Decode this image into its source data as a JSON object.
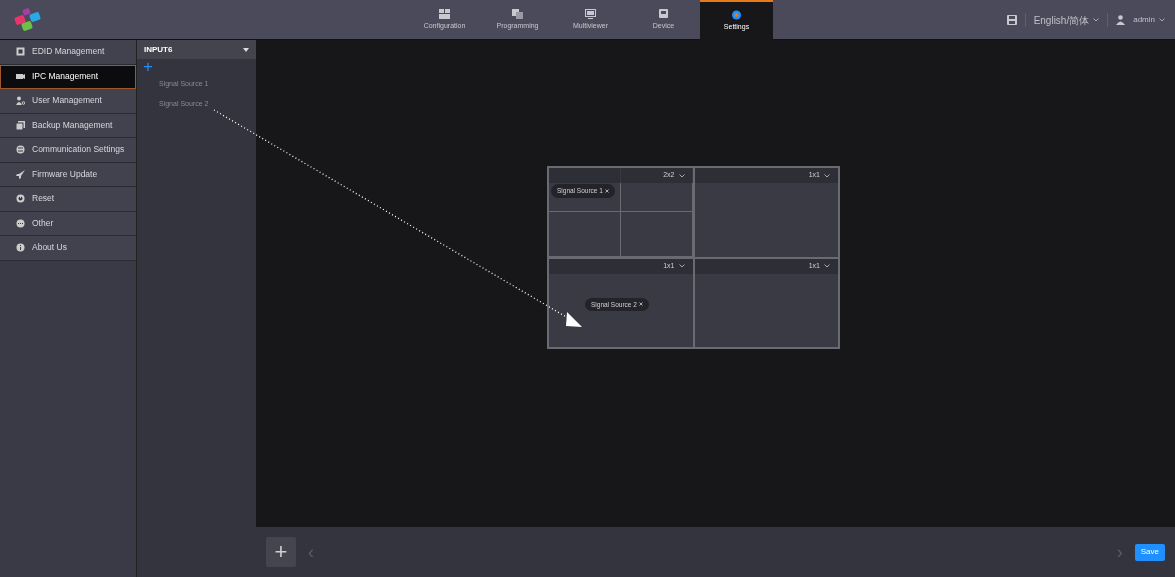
{
  "nav_tabs": [
    {
      "label": "Configuration",
      "selected": false
    },
    {
      "label": "Programming",
      "selected": false
    },
    {
      "label": "Multiviewer",
      "selected": false
    },
    {
      "label": "Device",
      "selected": false
    },
    {
      "label": "Settings",
      "selected": true
    }
  ],
  "header_right": {
    "language": "English/简体",
    "user": "admin"
  },
  "sidebar": {
    "items": [
      {
        "label": "EDID Management",
        "selected": false
      },
      {
        "label": "IPC Management",
        "selected": true
      },
      {
        "label": "User Management",
        "selected": false
      },
      {
        "label": "Backup Management",
        "selected": false
      },
      {
        "label": "Communication Settings",
        "selected": false
      },
      {
        "label": "Firmware Update",
        "selected": false
      },
      {
        "label": "Reset",
        "selected": false
      },
      {
        "label": "Other",
        "selected": false
      },
      {
        "label": "About Us",
        "selected": false
      }
    ]
  },
  "input_panel": {
    "title": "INPUT6",
    "add": "+",
    "sources": [
      "Signal Source 1",
      "Signal Source 2"
    ]
  },
  "windows": [
    {
      "mode": "2x2",
      "cells": [
        {
          "source": "Signal Source 1"
        },
        {},
        {},
        {}
      ]
    },
    {
      "mode": "1x1",
      "cells": [
        {}
      ]
    },
    {
      "mode": "1x1",
      "cells": [
        {
          "source": "Signal Source 2"
        }
      ]
    },
    {
      "mode": "1x1",
      "cells": [
        {}
      ]
    }
  ],
  "bottom_bar": {
    "add": "+",
    "prev": "‹",
    "next": "›",
    "save": "Save"
  }
}
